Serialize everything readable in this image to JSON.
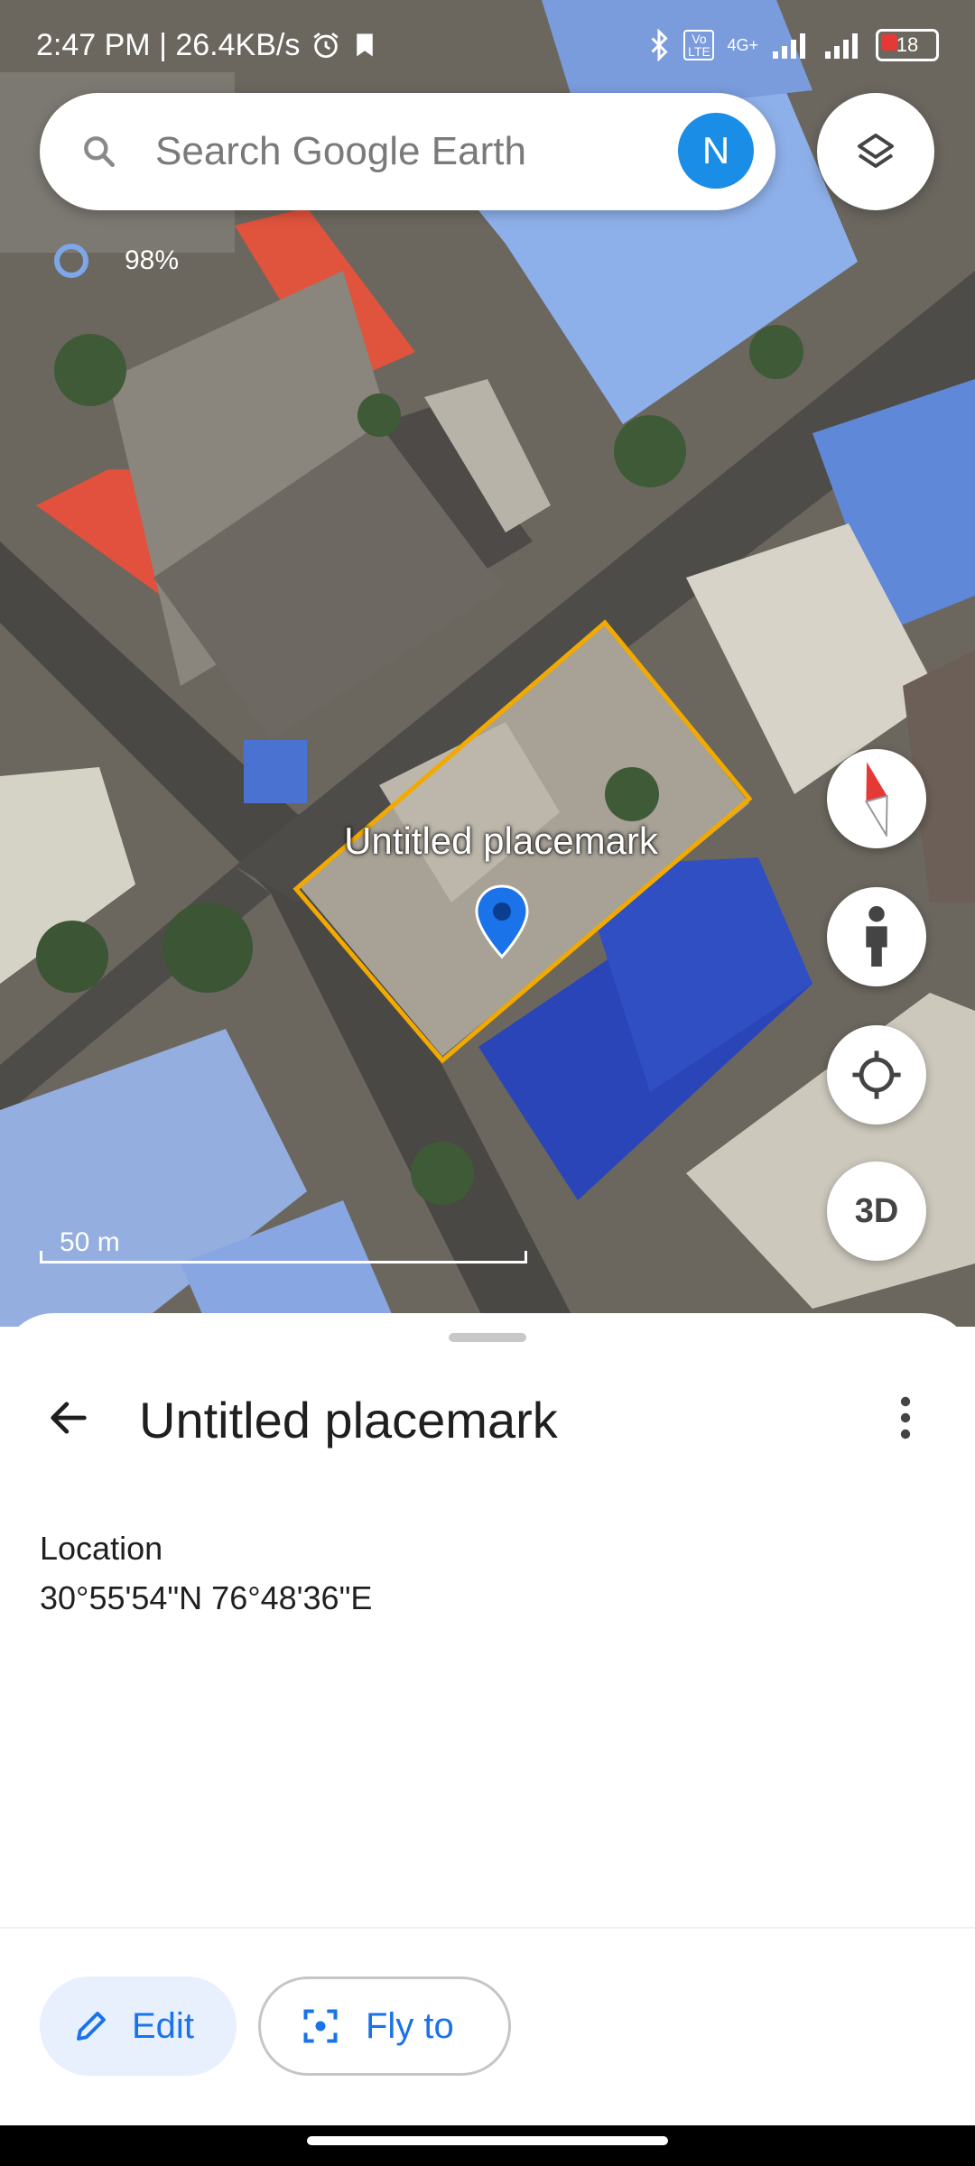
{
  "status_bar": {
    "time_speed": "2:47 PM | 26.4KB/s",
    "network": "4G+",
    "volte": "Vo LTE",
    "battery": "18"
  },
  "search": {
    "placeholder": "Search Google Earth",
    "avatar_initial": "N"
  },
  "loading": {
    "percent": "98%"
  },
  "map": {
    "placemark_label": "Untitled placemark",
    "scale_label": "50 m",
    "three_d_label": "3D",
    "accent_color": "#f2a900",
    "pin_color": "#1a73e8"
  },
  "sheet": {
    "title": "Untitled placemark",
    "location_heading": "Location",
    "location_value": "30°55'54\"N 76°48'36\"E",
    "edit_label": "Edit",
    "fly_to_label": "Fly to"
  }
}
